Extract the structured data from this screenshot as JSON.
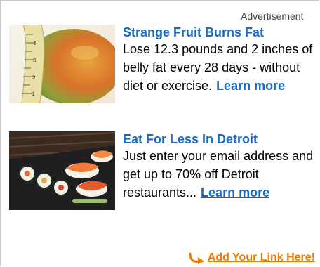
{
  "header": {
    "label": "Advertisement"
  },
  "ads": [
    {
      "title": "Strange Fruit Burns Fat",
      "description": "Lose 12.3 pounds and 2 inches of belly fat every 28 days - without diet or exercise.",
      "link_label": "Learn more",
      "image": "mango-with-measuring-tape"
    },
    {
      "title": "Eat For Less In Detroit",
      "description": "Just enter your email address and get up to 70% off Detroit restaurants...",
      "link_label": "Learn more",
      "image": "sushi-platter"
    }
  ],
  "footer": {
    "add_link_label": "Add Your Link Here!",
    "icon": "curved-arrow-icon",
    "accent_color": "#f07a00"
  },
  "colors": {
    "link_blue": "#1a6bc1",
    "border": "#c8c8c8"
  }
}
